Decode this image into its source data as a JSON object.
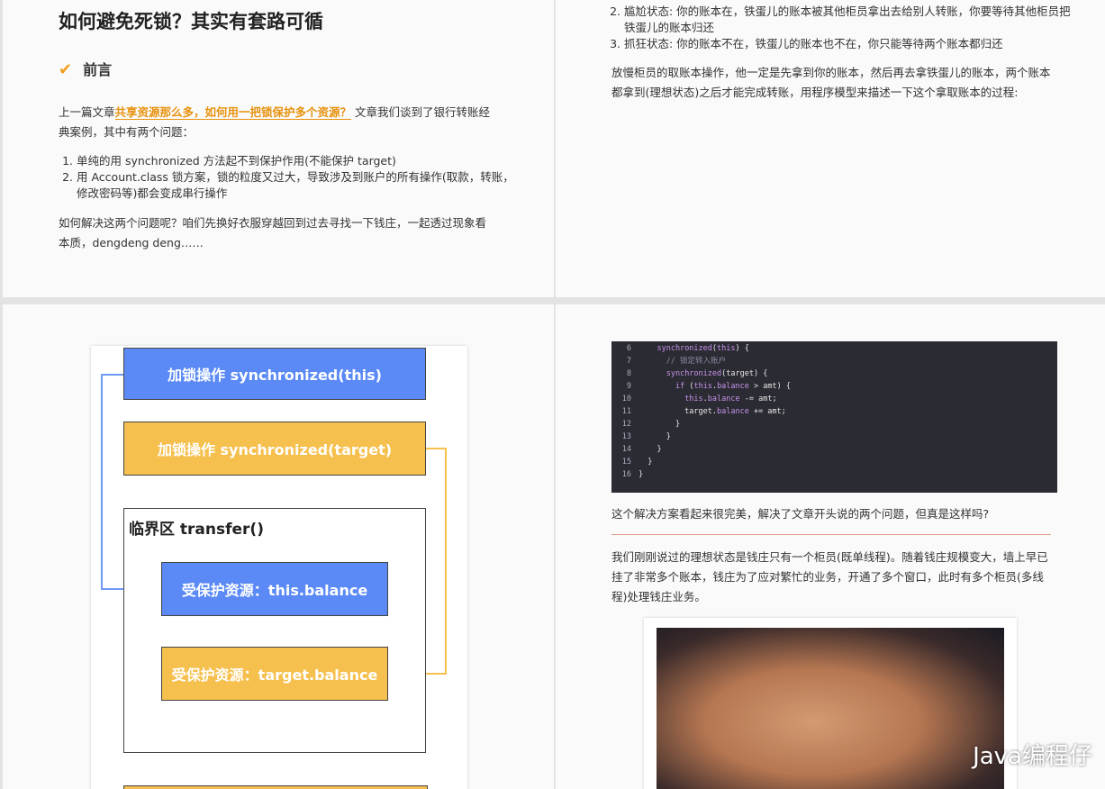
{
  "page1": {
    "title": "如何避免死锁？其实有套路可循",
    "section_heading": "前言",
    "intro_prefix": "上一篇文章",
    "intro_link": "共享资源那么多，如何用一把锁保护多个资源？",
    "intro_suffix": " 文章我们谈到了银行转账经典案例，其中有两个问题：",
    "problems": [
      "单纯的用 synchronized 方法起不到保护作用(不能保护 target)",
      "用 Account.class 锁方案，锁的粒度又过大，导致涉及到账户的所有操作(取款，转账，修改密码等)都会变成串行操作"
    ],
    "closing": "如何解决这两个问题呢？咱们先换好衣服穿越回到过去寻找一下钱庄，一起透过现象看本质，dengdeng deng……"
  },
  "page2": {
    "states": [
      "尴尬状态: 你的账本在，铁蛋儿的账本被其他柜员拿出去给别人转账，你要等待其他柜员把铁蛋儿的账本归还",
      "抓狂状态: 你的账本不在，铁蛋儿的账本也不在，你只能等待两个账本都归还"
    ],
    "paragraph": "放慢柜员的取账本操作，他一定是先拿到你的账本，然后再去拿铁蛋儿的账本，两个账本都拿到(理想状态)之后才能完成转账，用程序模型来描述一下这个拿取账本的过程:"
  },
  "page3": {
    "lock_this": "加锁操作 synchronized(this)",
    "lock_target": "加锁操作 synchronized(target)",
    "critical_label": "临界区 transfer()",
    "res_this": "受保护资源：this.balance",
    "res_target": "受保护资源：target.balance"
  },
  "page4": {
    "code_lines": [
      {
        "n": "6",
        "t": "    synchronized(this) {"
      },
      {
        "n": "7",
        "t": "      // 锁定转入账户"
      },
      {
        "n": "8",
        "t": "      synchronized(target) {"
      },
      {
        "n": "9",
        "t": "        if (this.balance > amt) {"
      },
      {
        "n": "10",
        "t": "          this.balance -= amt;"
      },
      {
        "n": "11",
        "t": "          target.balance += amt;"
      },
      {
        "n": "12",
        "t": "        }"
      },
      {
        "n": "13",
        "t": "      }"
      },
      {
        "n": "14",
        "t": "    }"
      },
      {
        "n": "15",
        "t": "  }"
      },
      {
        "n": "16",
        "t": "}"
      }
    ],
    "question": "这个解决方案看起来很完美，解决了文章开头说的两个问题，但真是这样吗?",
    "paragraph": "我们刚刚说过的理想状态是钱庄只有一个柜员(既单线程)。随着钱庄规模变大，墙上早已挂了非常多个账本，钱庄为了应对繁忙的业务，开通了多个窗口，此时有多个柜员(多线程)处理钱庄业务。",
    "watermark": "Java编程仔"
  },
  "colors": {
    "link": "#e8920e",
    "lock_blue": "#5b8af6",
    "lock_yellow": "#f6c04e",
    "code_bg": "#2b2b33"
  }
}
